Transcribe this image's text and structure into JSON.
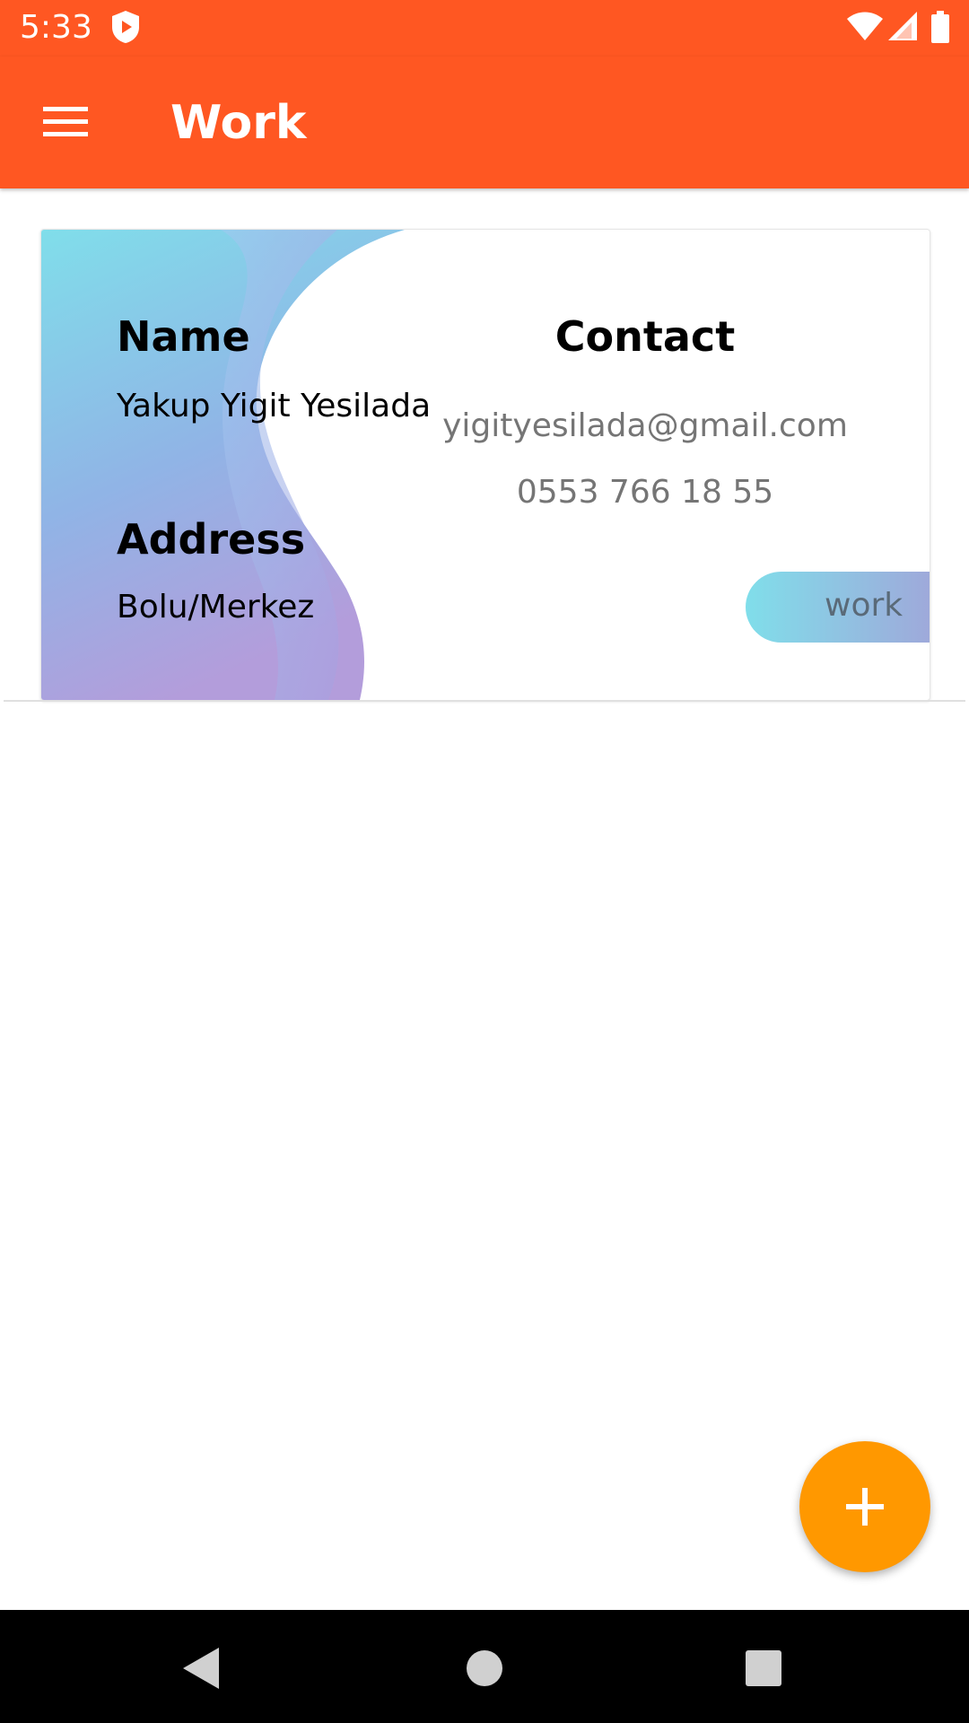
{
  "status_bar": {
    "time": "5:33",
    "icons": [
      "shield-play-icon",
      "wifi-icon",
      "cellular-signal-icon",
      "battery-icon"
    ]
  },
  "app_bar": {
    "title": "Work",
    "menu_icon": "hamburger-menu-icon"
  },
  "card": {
    "name_heading": "Name",
    "name_value": "Yakup Yigit Yesilada",
    "address_heading": "Address",
    "address_value": "Bolu/Merkez",
    "contact_heading": "Contact",
    "email": "yigityesilada@gmail.com",
    "phone": "0553 766 18 55",
    "tag": "work"
  },
  "fab": {
    "icon": "plus-icon"
  },
  "nav_bar": {
    "icons": [
      "back-triangle-icon",
      "home-circle-icon",
      "recents-square-icon"
    ]
  },
  "colors": {
    "app_bar": "#ff5722",
    "fab": "#ff9800",
    "card_gradient_top": "#80deea",
    "card_gradient_bottom": "#b39ddb"
  }
}
